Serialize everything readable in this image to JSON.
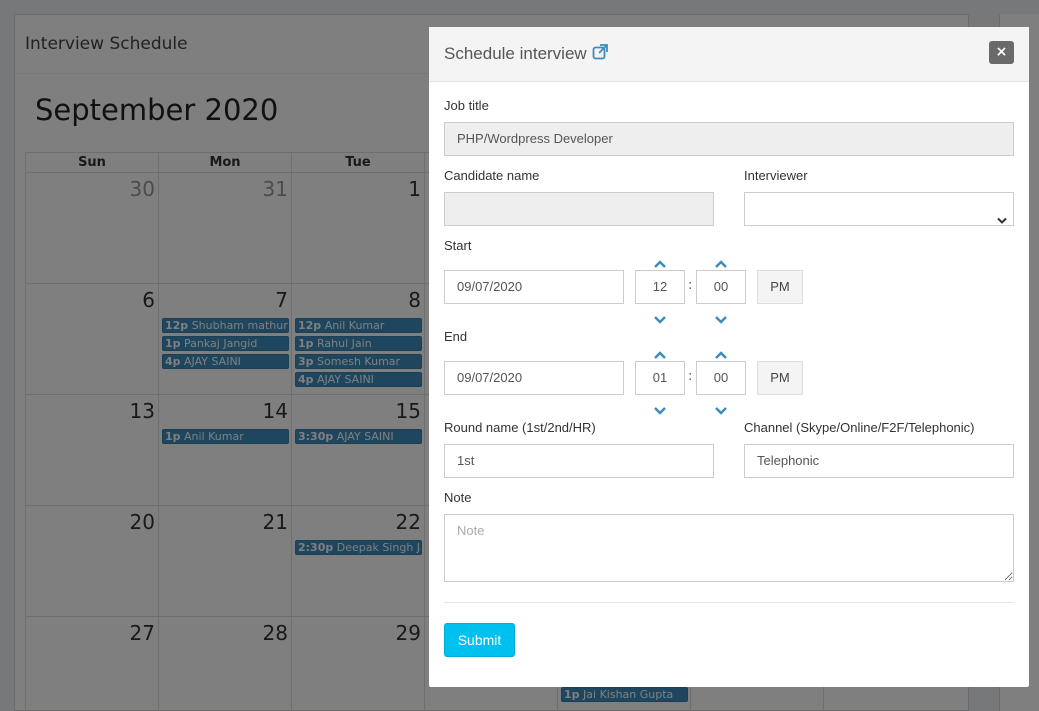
{
  "background": {
    "card_title": "Interview Schedule",
    "calendar_title": "September 2020",
    "weekdays": [
      "Sun",
      "Mon",
      "Tue",
      "",
      "",
      "",
      ""
    ],
    "weeks": [
      {
        "days": [
          "30",
          "31",
          "1",
          "",
          "",
          "",
          ""
        ]
      },
      {
        "days": [
          "6",
          "7",
          "8",
          "",
          "",
          "",
          ""
        ]
      },
      {
        "days": [
          "13",
          "14",
          "15",
          "",
          "",
          "",
          ""
        ]
      },
      {
        "days": [
          "20",
          "21",
          "22",
          "",
          "",
          "",
          ""
        ]
      },
      {
        "days": [
          "27",
          "28",
          "29",
          "",
          "",
          "",
          ""
        ]
      }
    ],
    "events": {
      "mon7_1_time": "12p",
      "mon7_1_name": "Shubham mathur",
      "mon7_2_time": "1p",
      "mon7_2_name": "Pankaj Jangid",
      "mon7_3_time": "4p",
      "mon7_3_name": "AJAY SAINI",
      "tue8_1_time": "12p",
      "tue8_1_name": "Anil Kumar",
      "tue8_2_time": "1p",
      "tue8_2_name": "Rahul Jain",
      "tue8_3_time": "3p",
      "tue8_3_name": "Somesh Kumar",
      "tue8_4_time": "4p",
      "tue8_4_name": "AJAY SAINI",
      "mon14_1_time": "1p",
      "mon14_1_name": "Anil Kumar",
      "tue15_1_time": "3:30p",
      "tue15_1_name": "AJAY SAINI",
      "tue22_1_time": "2:30p",
      "tue22_1_name": "Deepak Singh Jai",
      "thu_1_time": "1p",
      "thu_1_name": "Jai Kishan Gupta"
    },
    "event_color": "#3c8dbc"
  },
  "modal": {
    "title": "Schedule interview",
    "close_label": "×",
    "job_title_label": "Job title",
    "job_title_value": "PHP/Wordpress Developer",
    "candidate_label": "Candidate name",
    "candidate_value": "",
    "interviewer_label": "Interviewer",
    "interviewer_value": "",
    "start_label": "Start",
    "start_date": "09/07/2020",
    "start_hour": "12",
    "start_minute": "00",
    "start_ampm": "PM",
    "end_label": "End",
    "end_date": "09/07/2020",
    "end_hour": "01",
    "end_minute": "00",
    "end_ampm": "PM",
    "round_label": "Round name (1st/2nd/HR)",
    "round_value": "1st",
    "channel_label": "Channel (Skype/Online/F2F/Telephonic)",
    "channel_value": "Telephonic",
    "note_label": "Note",
    "note_placeholder": "Note",
    "submit_label": "Submit",
    "accent_color": "#00c0ef"
  }
}
